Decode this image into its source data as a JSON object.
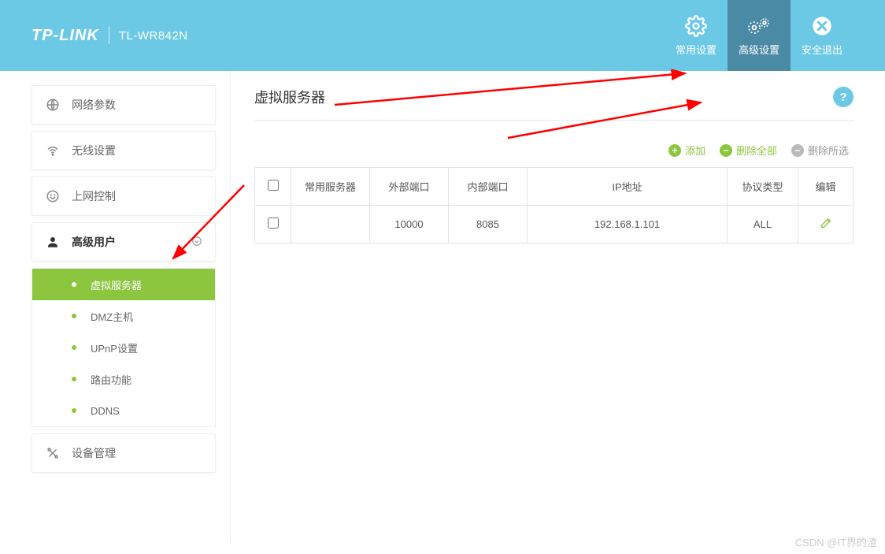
{
  "header": {
    "logo": "TP-LINK",
    "model": "TL-WR842N",
    "nav": {
      "common": "常用设置",
      "advanced": "高级设置",
      "logout": "安全退出"
    }
  },
  "sidebar": {
    "network": "网络参数",
    "wireless": "无线设置",
    "access": "上网控制",
    "advuser": "高级用户",
    "device": "设备管理",
    "sub": {
      "vserver": "虚拟服务器",
      "dmz": "DMZ主机",
      "upnp": "UPnP设置",
      "route": "路由功能",
      "ddns": "DDNS"
    }
  },
  "main": {
    "title": "虚拟服务器",
    "help": "?",
    "actions": {
      "add": "添加",
      "delall": "删除全部",
      "delsel": "删除所选"
    },
    "columns": {
      "srv": "常用服务器",
      "ext": "外部端口",
      "int": "内部端口",
      "ip": "IP地址",
      "proto": "协议类型",
      "edit": "编辑"
    },
    "rows": [
      {
        "srv": "",
        "ext": "10000",
        "int": "8085",
        "ip": "192.168.1.101",
        "proto": "ALL"
      }
    ]
  },
  "watermark": "CSDN @IT界的渣"
}
